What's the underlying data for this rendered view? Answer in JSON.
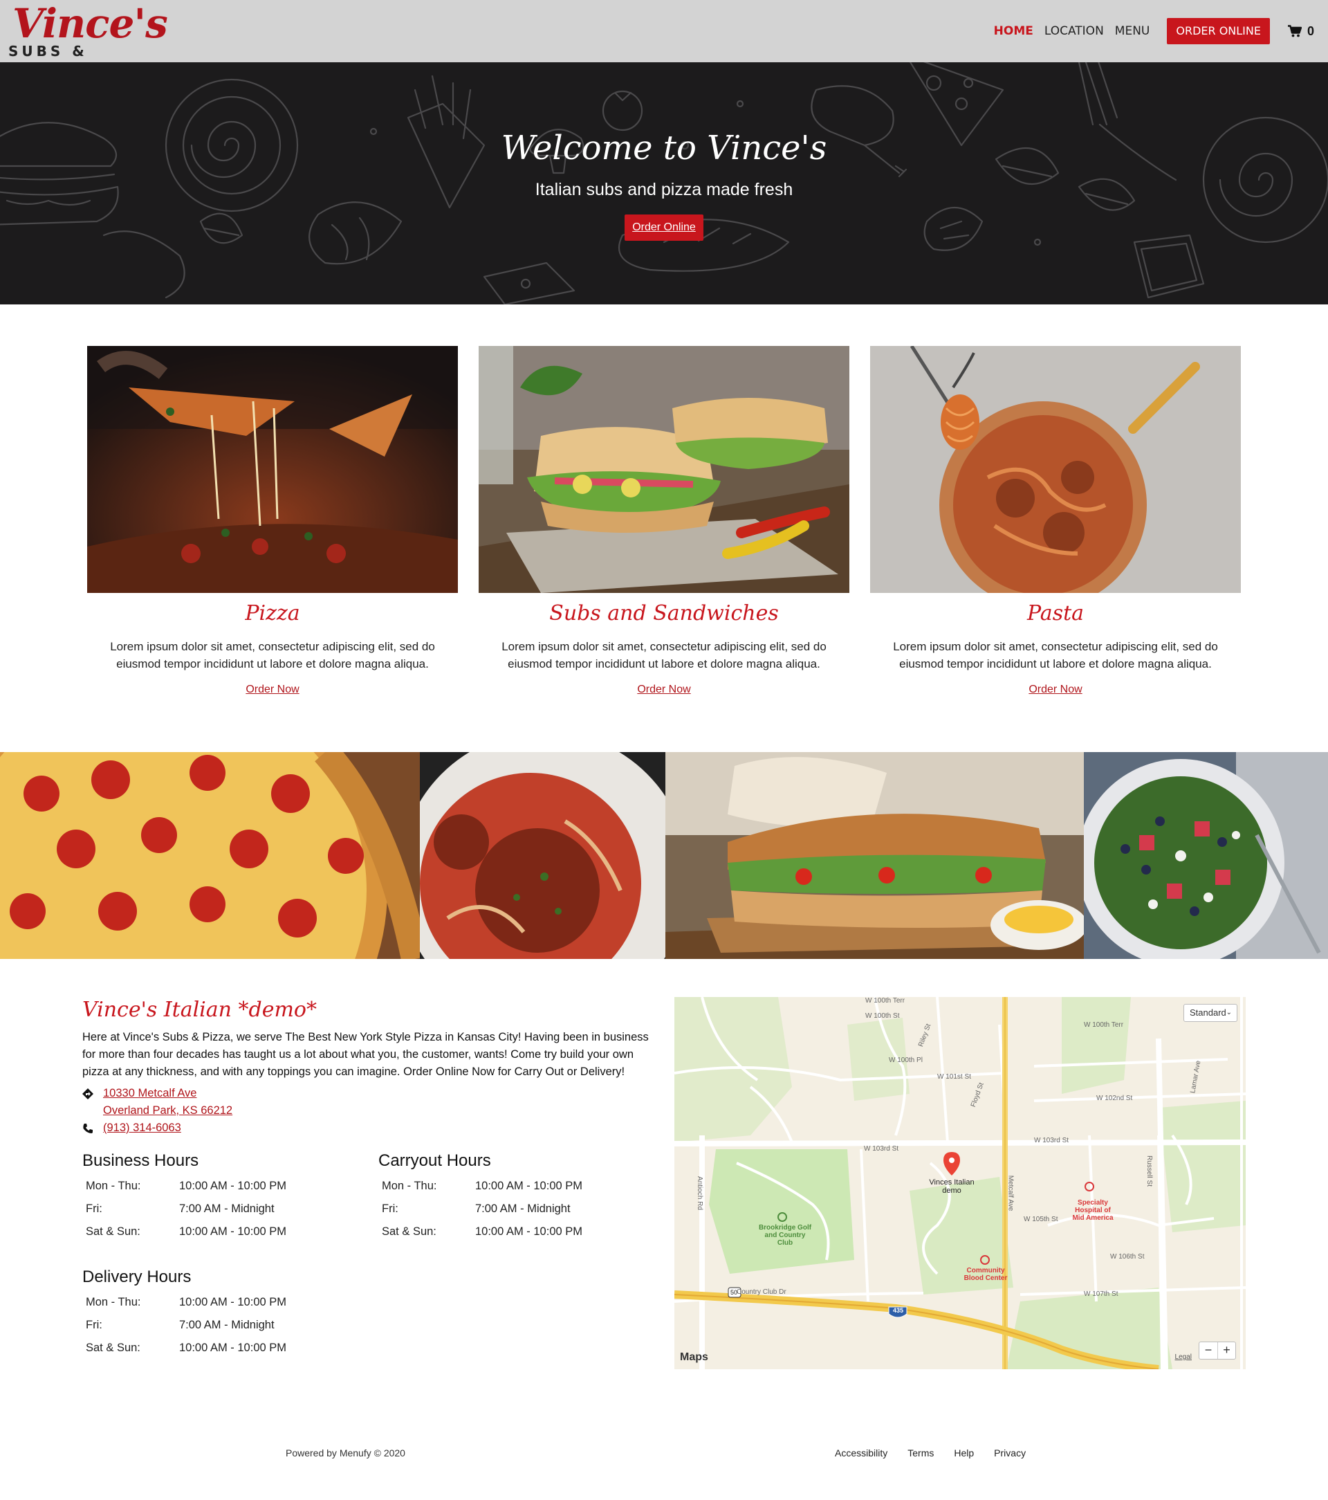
{
  "brand": {
    "logo_script": "Vince's",
    "logo_sub": "SUBS & PIZZA",
    "accent_color": "#c8161d",
    "header_bg": "#d3d3d3",
    "hero_bg": "#1c1b1c"
  },
  "nav": {
    "items": [
      {
        "label": "HOME",
        "active": true
      },
      {
        "label": "LOCATION",
        "active": false
      },
      {
        "label": "MENU",
        "active": false
      }
    ],
    "order_label": "ORDER ONLINE",
    "cart_icon": "cart-icon",
    "cart_count": "0"
  },
  "hero": {
    "title": "Welcome to Vince's",
    "subtitle": "Italian subs and pizza made fresh",
    "button_label": "Order Online"
  },
  "cards": [
    {
      "title": "Pizza",
      "description": "Lorem ipsum dolor sit amet, consectetur adipiscing elit, sed do eiusmod tempor incididunt ut labore et dolore magna aliqua.",
      "link_label": "Order Now"
    },
    {
      "title": "Subs and Sandwiches",
      "description": "Lorem ipsum dolor sit amet, consectetur adipiscing elit, sed do eiusmod tempor incididunt ut labore et dolore magna aliqua.",
      "link_label": "Order Now"
    },
    {
      "title": "Pasta",
      "description": "Lorem ipsum dolor sit amet, consectetur adipiscing elit, sed do eiusmod tempor incididunt ut labore et dolore magna aliqua.",
      "link_label": "Order Now"
    }
  ],
  "info": {
    "title": "Vince's Italian *demo*",
    "description": "Here at Vince's Subs & Pizza, we serve The Best New York Style Pizza in Kansas City! Having been in business for more than four decades has taught us a lot about what you, the customer, wants! Come try build your own pizza at any thickness, and with any toppings you can imagine. Order Online Now for Carry Out or Delivery!",
    "address_line1": "10330 Metcalf Ave",
    "address_line2": "Overland Park, KS 66212",
    "phone": "(913) 314-6063"
  },
  "hours": {
    "business": {
      "title": "Business Hours",
      "rows": [
        {
          "day": "Mon - Thu:",
          "time": "10:00 AM - 10:00 PM"
        },
        {
          "day": "Fri:",
          "time": "7:00 AM - Midnight"
        },
        {
          "day": "Sat & Sun:",
          "time": "10:00 AM - 10:00 PM"
        }
      ]
    },
    "carryout": {
      "title": "Carryout Hours",
      "rows": [
        {
          "day": "Mon - Thu:",
          "time": "10:00 AM - 10:00 PM"
        },
        {
          "day": "Fri:",
          "time": "7:00 AM - Midnight"
        },
        {
          "day": "Sat & Sun:",
          "time": "10:00 AM - 10:00 PM"
        }
      ]
    },
    "delivery": {
      "title": "Delivery Hours",
      "rows": [
        {
          "day": "Mon - Thu:",
          "time": "10:00 AM - 10:00 PM"
        },
        {
          "day": "Fri:",
          "time": "7:00 AM - Midnight"
        },
        {
          "day": "Sat & Sun:",
          "time": "10:00 AM - 10:00 PM"
        }
      ]
    }
  },
  "map": {
    "style_select": "Standard",
    "brand": "Maps",
    "legal": "Legal",
    "zoom_out": "−",
    "zoom_in": "+",
    "pin_label": "Vinces Italian demo",
    "labels": {
      "w100th_terr": "W 100th Terr",
      "w100th_st": "W 100th St",
      "w100th_pl": "W 100th Pl",
      "w101st_st": "W 101st St",
      "w102nd_st": "W 102nd St",
      "w103rd_st": "W 103rd St",
      "w103rd_st_2": "W 103rd St",
      "w105th_st": "W 105th St",
      "w106th_st": "W 106th St",
      "w107th_st": "W 107th St",
      "antioch": "Antioch Rd",
      "metcalf": "Metcalf Ave",
      "lamar": "Lamar Ave",
      "russell": "Russell St",
      "riley": "Riley St",
      "floyd": "Floyd St",
      "country_club": "Country Club Dr",
      "hospital": "Specialty Hospital of Mid America",
      "golf": "Brookridge Golf and Country Club",
      "blood": "Community Blood Center",
      "hwy50": "50",
      "hwy435": "435"
    }
  },
  "footer": {
    "powered": "Powered by Menufy © 2020",
    "links": [
      "Accessibility",
      "Terms",
      "Help",
      "Privacy"
    ]
  }
}
